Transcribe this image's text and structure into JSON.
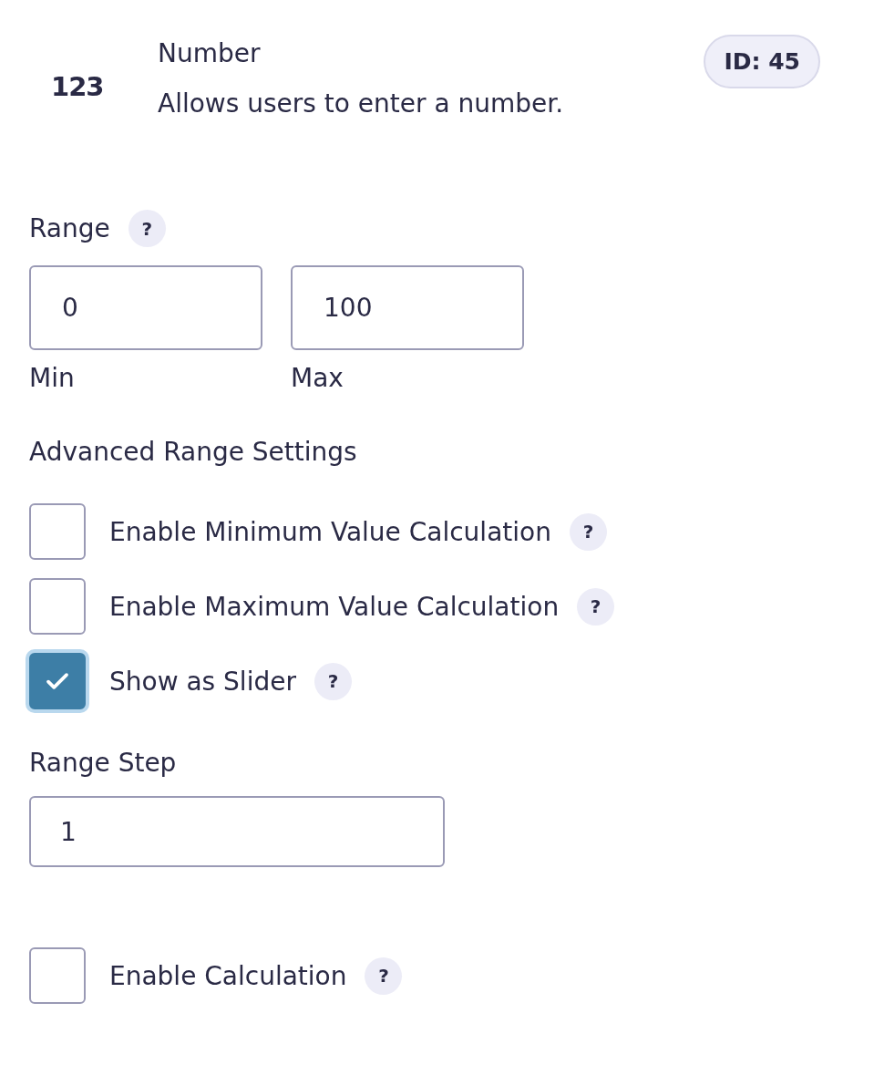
{
  "header": {
    "icon_text": "123",
    "title": "Number",
    "description": "Allows users to enter a number.",
    "id_badge": "ID: 45"
  },
  "range": {
    "label": "Range",
    "help": "?",
    "min": {
      "value": "0",
      "label": "Min"
    },
    "max": {
      "value": "100",
      "label": "Max"
    }
  },
  "advanced": {
    "label": "Advanced Range Settings",
    "options": [
      {
        "label": "Enable Minimum Value Calculation",
        "checked": false,
        "help": "?"
      },
      {
        "label": "Enable Maximum Value Calculation",
        "checked": false,
        "help": "?"
      },
      {
        "label": "Show as Slider",
        "checked": true,
        "help": "?"
      }
    ]
  },
  "range_step": {
    "label": "Range Step",
    "value": "1"
  },
  "calculation": {
    "label": "Enable Calculation",
    "checked": false,
    "help": "?"
  }
}
